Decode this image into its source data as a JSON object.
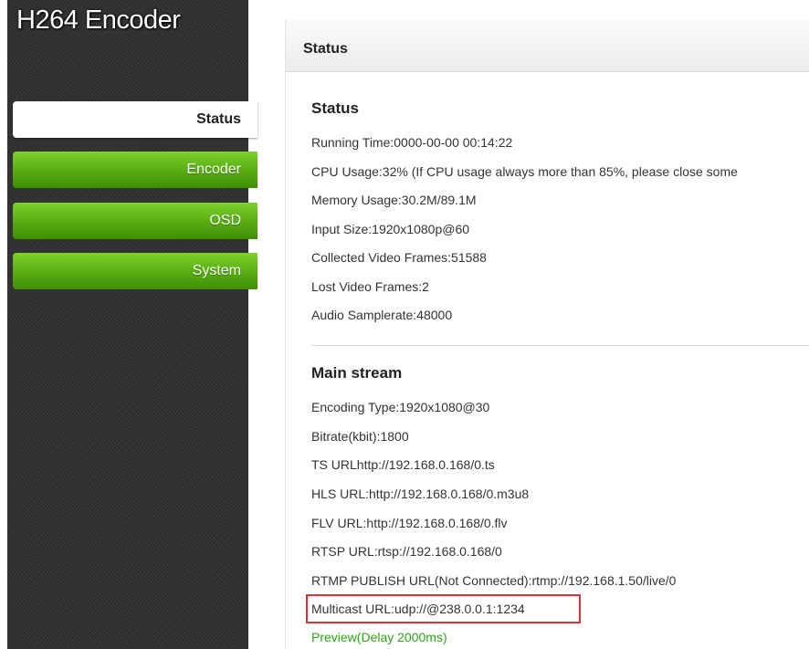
{
  "app": {
    "title": "H264 Encoder"
  },
  "nav": {
    "items": [
      {
        "label": "Status",
        "active": true
      },
      {
        "label": "Encoder",
        "active": false
      },
      {
        "label": "OSD",
        "active": false
      },
      {
        "label": "System",
        "active": false
      }
    ]
  },
  "main": {
    "header": "Status",
    "status": {
      "title": "Status",
      "lines": [
        "Running Time:0000-00-00 00:14:22",
        "CPU Usage:32% (If CPU usage always more than 85%, please close some",
        "Memory Usage:30.2M/89.1M",
        "Input Size:1920x1080p@60",
        "Collected Video Frames:51588",
        "Lost Video Frames:2",
        "Audio Samplerate:48000"
      ]
    },
    "main_stream": {
      "title": "Main stream",
      "lines": [
        "Encoding Type:1920x1080@30",
        "Bitrate(kbit):1800",
        "TS URLhttp://192.168.0.168/0.ts",
        "HLS URL:http://192.168.0.168/0.m3u8",
        "FLV URL:http://192.168.0.168/0.flv",
        "RTSP URL:rtsp://192.168.0.168/0",
        "RTMP PUBLISH URL(Not Connected):rtmp://192.168.1.50/live/0",
        "Multicast URL:udp://@238.0.0.1:1234"
      ],
      "preview_link": "Preview(Delay 2000ms)"
    }
  },
  "colors": {
    "nav_green": "#5cb314",
    "preview_link": "#2ea318",
    "highlight_border": "#d9333a",
    "sidebar_bg": "#333333"
  }
}
